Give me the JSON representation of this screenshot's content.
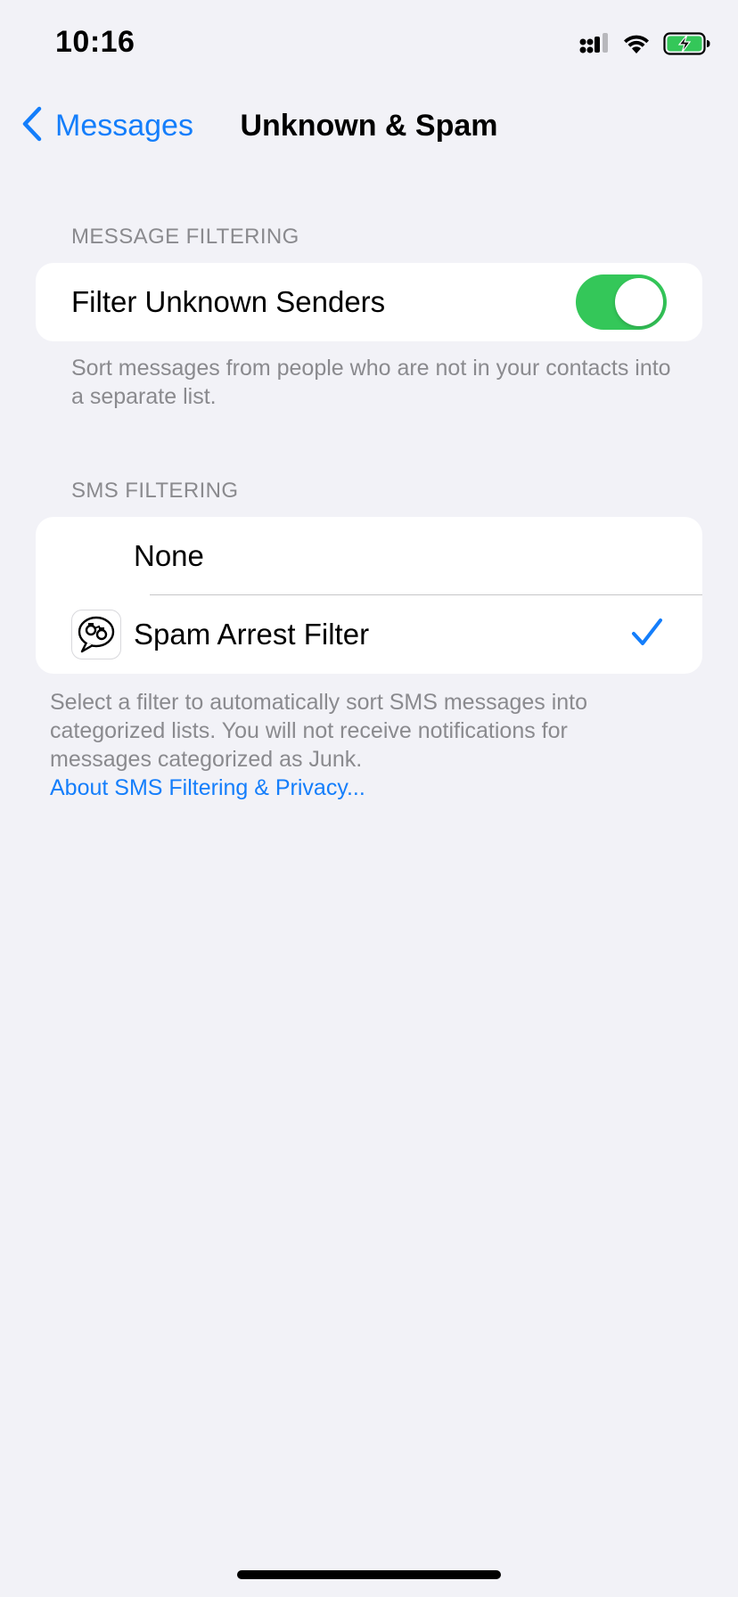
{
  "colors": {
    "accent": "#147EFB",
    "toggle_on": "#34C759",
    "background": "#F2F2F7",
    "secondary_text": "#8A8A8E"
  },
  "status_bar": {
    "time": "10:16",
    "icons": [
      "cellular-signal-icon",
      "wifi-icon",
      "battery-charging-icon"
    ]
  },
  "nav": {
    "back_label": "Messages",
    "title": "Unknown & Spam"
  },
  "message_filtering": {
    "header": "MESSAGE FILTERING",
    "filter_unknown_label": "Filter Unknown Senders",
    "filter_unknown_on": true,
    "footer": "Sort messages from people who are not in your contacts into a separate list."
  },
  "sms_filtering": {
    "header": "SMS FILTERING",
    "options": [
      {
        "label": "None",
        "selected": false
      },
      {
        "label": "Spam Arrest Filter",
        "selected": true,
        "icon": "spam-arrest-app-icon"
      }
    ],
    "footer": "Select a filter to automatically sort SMS messages into categorized lists. You will not receive notifications for messages categorized as Junk.",
    "link": "About SMS Filtering & Privacy..."
  }
}
